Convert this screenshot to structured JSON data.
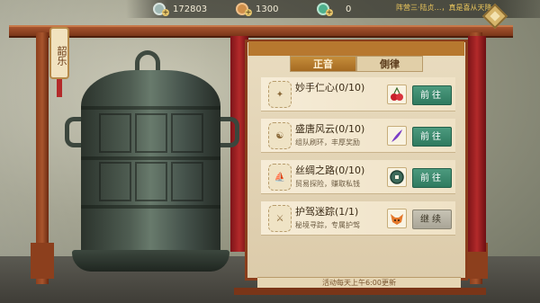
{
  "resources": [
    {
      "name": "silver-coin-icon",
      "value": "172803",
      "color": "#9fb7b3"
    },
    {
      "name": "copper-coin-icon",
      "value": "1300",
      "color": "#d08f4a"
    },
    {
      "name": "jade-icon",
      "value": "0",
      "color": "#4eb08c"
    }
  ],
  "marquee_text": "阵营三·陆贞…，真是喜从天降",
  "sign_label": "韶乐",
  "tabs": [
    {
      "label": "正音",
      "active": true
    },
    {
      "label": "側律",
      "active": false
    }
  ],
  "tasks": [
    {
      "title": "妙手仁心(0/10)",
      "desc": "",
      "item_icon": "cherry-icon",
      "button": "前往",
      "button_type": "go"
    },
    {
      "title": "盛唐风云(0/10)",
      "desc": "组队刷环，丰厚奖励",
      "item_icon": "purple-feather-icon",
      "button": "前往",
      "button_type": "go"
    },
    {
      "title": "丝绸之路(0/10)",
      "desc": "贸易探险，赚取私钱",
      "item_icon": "coin-icon",
      "button": "前往",
      "button_type": "go"
    },
    {
      "title": "护驾迷踪(1/1)",
      "desc": "秘境寻踪，专属护驾",
      "item_icon": "fox-icon",
      "button": "继续",
      "button_type": "continue"
    }
  ],
  "footer_text": "活动每天上午6:00更新"
}
